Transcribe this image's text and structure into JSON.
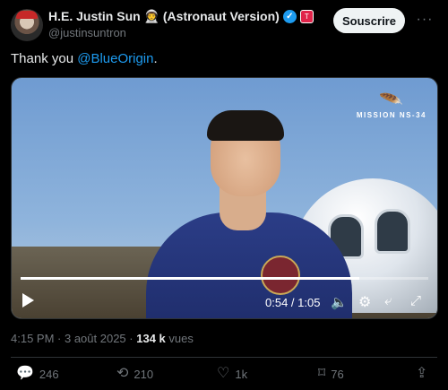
{
  "author": {
    "display_name": "H.E. Justin Sun 👨‍🚀 (Astronaut Version)",
    "handle": "@justinsuntron",
    "verified_icon": "verified-check-icon",
    "affiliation_icon": "affiliation-badge-icon"
  },
  "subscribe_label": "Souscrire",
  "more_icon": "more-options-icon",
  "tweet": {
    "text": "Thank you ",
    "mention": "@BlueOrigin",
    "suffix": "."
  },
  "video": {
    "mission_label": "MISSION NS-34",
    "logo_icon": "blue-origin-feather-icon",
    "current_time": "0:54",
    "duration": "1:05",
    "time_display": "0:54 / 1:05",
    "progress": 0.83,
    "controls": [
      "play-icon",
      "volume-icon",
      "settings-icon",
      "picture-in-picture-icon",
      "fullscreen-icon"
    ]
  },
  "meta": {
    "time": "4:15 PM",
    "date": "3 août 2025",
    "views_count": "134 k",
    "views_label": "vues"
  },
  "actions": {
    "replies": "246",
    "reposts": "210",
    "likes": "1k",
    "bookmarks": "76"
  },
  "colors": {
    "accent": "#1d9bf0",
    "background": "#000000",
    "muted": "#71767b"
  }
}
